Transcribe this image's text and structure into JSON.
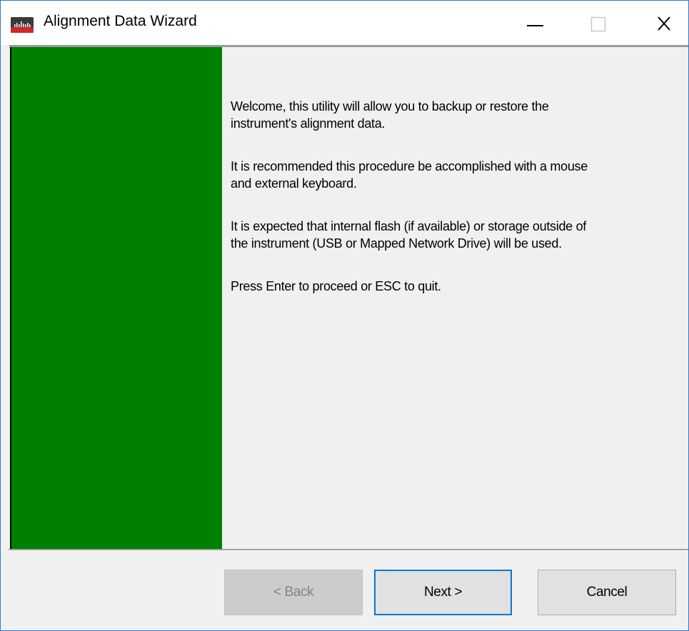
{
  "window": {
    "title": "Alignment Data Wizard",
    "icon": "instrument-app-icon",
    "controls": {
      "minimize": "minimize-icon",
      "maximize": "maximize-icon",
      "close": "close-icon"
    }
  },
  "side_panel": {
    "color": "#008000"
  },
  "content": {
    "paragraphs": [
      "Welcome, this utility will allow you to backup or restore the\ninstrument's alignment data.",
      "It is recommended this procedure be accomplished with a mouse\nand external keyboard.",
      "It is expected that internal flash (if available) or storage outside of\nthe instrument (USB or Mapped Network Drive) will be used.",
      "Press Enter to proceed or ESC to quit."
    ]
  },
  "buttons": {
    "back": {
      "label": "< Back",
      "enabled": false
    },
    "next": {
      "label": "Next >",
      "enabled": true,
      "default": true
    },
    "cancel": {
      "label": "Cancel",
      "enabled": true
    }
  },
  "colors": {
    "accent": "#0078d7",
    "panel_green": "#008000",
    "background": "#f0f0f0",
    "icon_red": "#d02828"
  }
}
